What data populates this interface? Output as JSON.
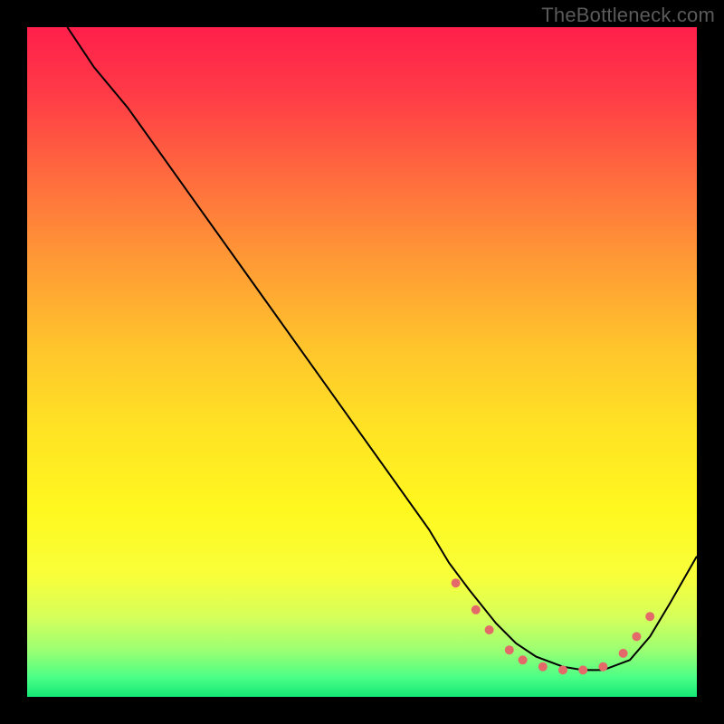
{
  "watermark": "TheBottleneck.com",
  "chart_data": {
    "type": "line",
    "title": "",
    "xlabel": "",
    "ylabel": "",
    "xlim": [
      0,
      100
    ],
    "ylim": [
      0,
      100
    ],
    "x_axis_inverted": false,
    "y_axis_inverted": true,
    "background_gradient_stops": [
      {
        "offset": 0.0,
        "color": "#ff1f4b"
      },
      {
        "offset": 0.1,
        "color": "#ff3b47"
      },
      {
        "offset": 0.22,
        "color": "#ff6a3e"
      },
      {
        "offset": 0.35,
        "color": "#ff9a35"
      },
      {
        "offset": 0.48,
        "color": "#ffc52c"
      },
      {
        "offset": 0.6,
        "color": "#ffe324"
      },
      {
        "offset": 0.72,
        "color": "#fff81f"
      },
      {
        "offset": 0.82,
        "color": "#f8ff3a"
      },
      {
        "offset": 0.88,
        "color": "#d6ff5a"
      },
      {
        "offset": 0.93,
        "color": "#9cff72"
      },
      {
        "offset": 0.97,
        "color": "#4dff86"
      },
      {
        "offset": 1.0,
        "color": "#14e877"
      }
    ],
    "series": [
      {
        "name": "bottleneck-curve",
        "color": "#000000",
        "stroke_width": 2,
        "x": [
          6,
          10,
          15,
          20,
          25,
          30,
          35,
          40,
          45,
          50,
          55,
          60,
          63,
          66,
          70,
          73,
          76,
          80,
          83,
          86,
          90,
          93,
          96,
          100
        ],
        "y": [
          0,
          6,
          12,
          19,
          26,
          33,
          40,
          47,
          54,
          61,
          68,
          75,
          80,
          84,
          89,
          92,
          94,
          95.5,
          96,
          96,
          94.5,
          91,
          86,
          79
        ]
      }
    ],
    "markers": {
      "name": "optimal-zone-dots",
      "color": "#e46a6a",
      "radius": 5,
      "points": [
        {
          "x": 64,
          "y": 83
        },
        {
          "x": 67,
          "y": 87
        },
        {
          "x": 69,
          "y": 90
        },
        {
          "x": 72,
          "y": 93
        },
        {
          "x": 74,
          "y": 94.5
        },
        {
          "x": 77,
          "y": 95.5
        },
        {
          "x": 80,
          "y": 96
        },
        {
          "x": 83,
          "y": 96
        },
        {
          "x": 86,
          "y": 95.5
        },
        {
          "x": 89,
          "y": 93.5
        },
        {
          "x": 91,
          "y": 91
        },
        {
          "x": 93,
          "y": 88
        }
      ]
    }
  }
}
